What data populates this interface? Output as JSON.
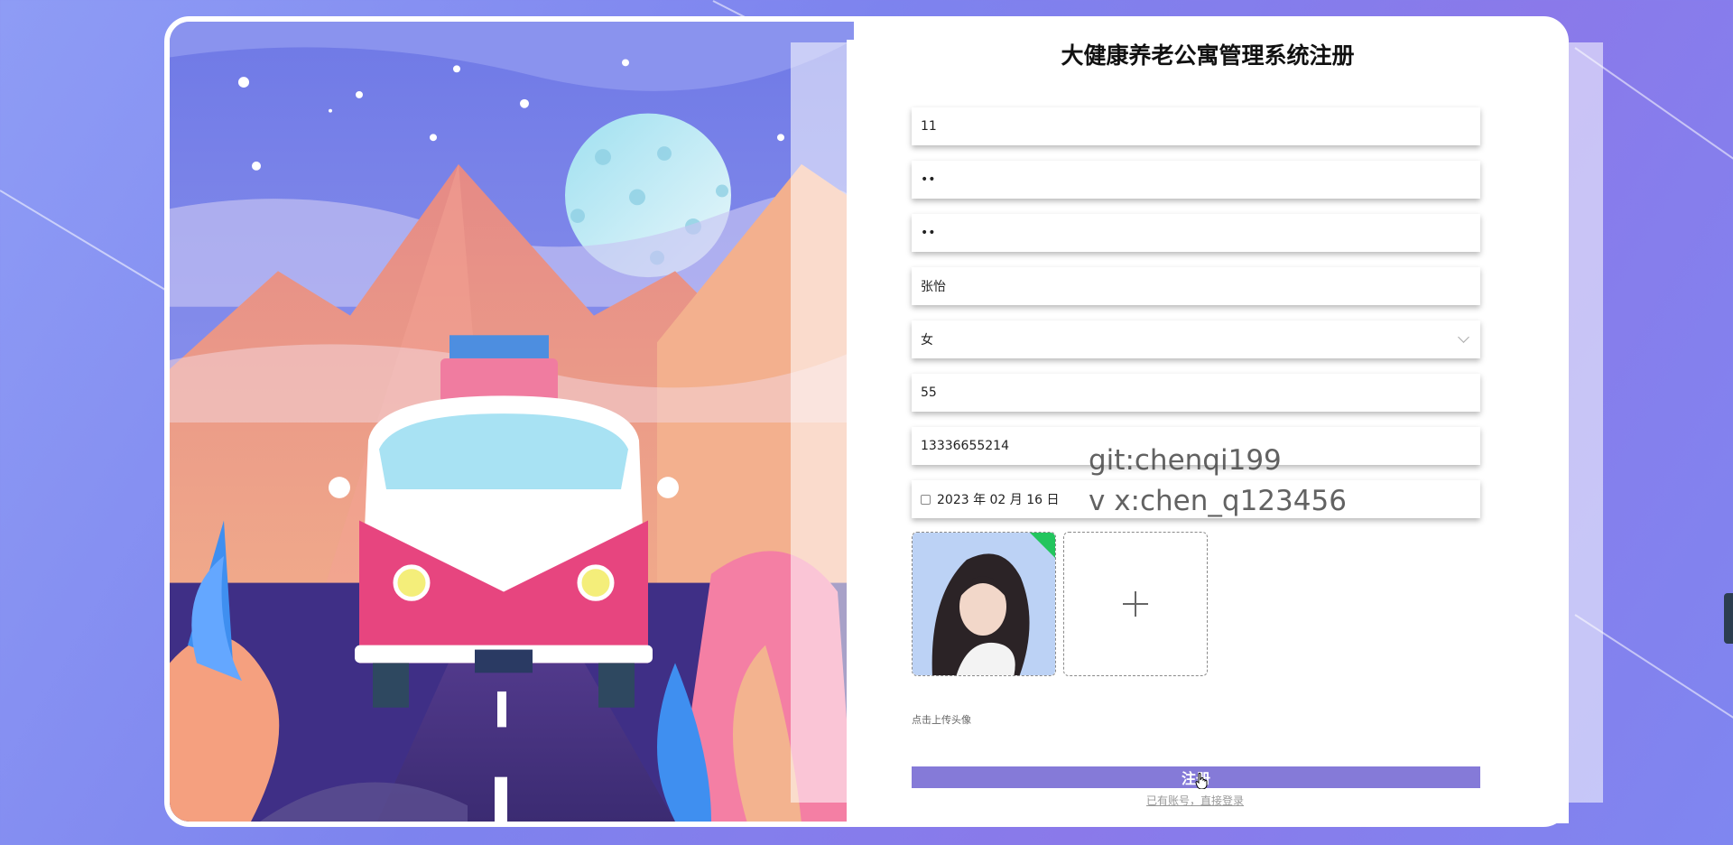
{
  "form": {
    "title": "大健康养老公寓管理系统注册",
    "fields": [
      {
        "name": "account",
        "value": "11"
      },
      {
        "name": "password",
        "value": "••"
      },
      {
        "name": "confirm-password",
        "value": "••"
      },
      {
        "name": "real-name",
        "value": "张怡"
      },
      {
        "name": "gender",
        "value": "女"
      },
      {
        "name": "age",
        "value": "55"
      },
      {
        "name": "phone",
        "value": "13336655214"
      },
      {
        "name": "birth-date",
        "value": "2023 年 02 月 16 日"
      }
    ],
    "upload_hint": "点击上传头像",
    "submit_label": "注册",
    "login_link": "已有账号，直接登录"
  },
  "watermark": {
    "line1": "git:chenqi199",
    "line2": "v x:chen_q123456"
  },
  "colors": {
    "submit": "#857ad8",
    "background": "#8a85f0"
  }
}
